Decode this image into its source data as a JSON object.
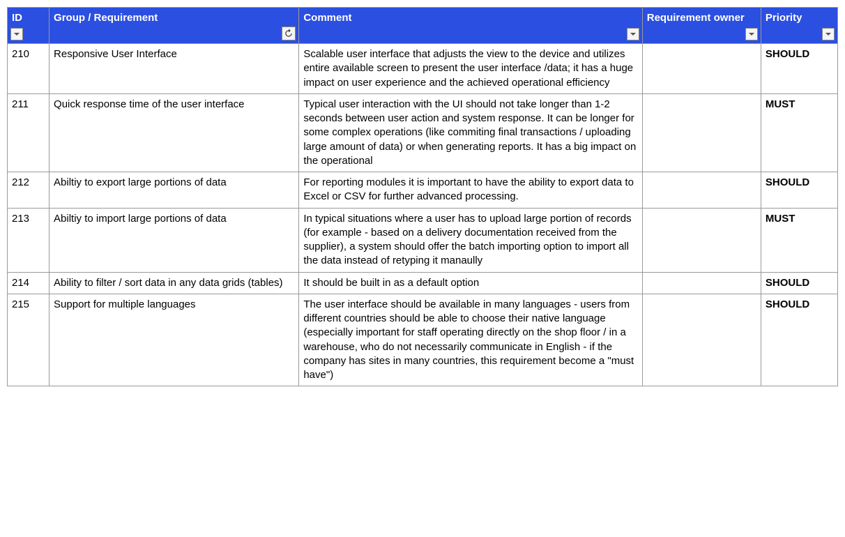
{
  "columns": {
    "id": "ID",
    "requirement": "Group / Requirement",
    "comment": "Comment",
    "owner": "Requirement owner",
    "priority": "Priority"
  },
  "rows": [
    {
      "id": "210",
      "requirement": "Responsive User Interface",
      "comment": "Scalable user interface that adjusts the view to the device and utilizes entire available screen to present the user interface /data; it has a huge impact on user experience and the achieved operational efficiency",
      "owner": "",
      "priority": "SHOULD"
    },
    {
      "id": "211",
      "requirement": "Quick response time of the user interface",
      "comment": "Typical user interaction with the UI should not take longer than 1-2 seconds between user action and system response. It can be longer for some complex operations (like commiting final transactions / uploading large amount of data) or when generating reports. It has a big impact on the operational",
      "owner": "",
      "priority": "MUST"
    },
    {
      "id": "212",
      "requirement": "Abiltiy to export large portions of data",
      "comment": "For reporting modules it is important to have the ability to export data to Excel or CSV for further advanced processing.",
      "owner": "",
      "priority": "SHOULD"
    },
    {
      "id": "213",
      "requirement": "Abiltiy to import large portions of data",
      "comment": "In typical situations where a user has to upload large portion of records (for example - based on a delivery documentation received from the supplier), a system should offer the batch importing option to import all the data instead of retyping it manaully",
      "owner": "",
      "priority": "MUST"
    },
    {
      "id": "214",
      "requirement": "Ability to filter / sort data in any data grids (tables)",
      "comment": "It should be built in as a default option",
      "owner": "",
      "priority": "SHOULD"
    },
    {
      "id": "215",
      "requirement": "Support for multiple languages",
      "comment": "The user interface should be available in many languages - users from different countries should be able to choose their native language (especially important for staff operating directly on the shop floor / in a warehouse, who do not necessarily communicate in English - if the company has sites in many countries, this requirement become a \"must have\")",
      "owner": "",
      "priority": "SHOULD"
    }
  ]
}
